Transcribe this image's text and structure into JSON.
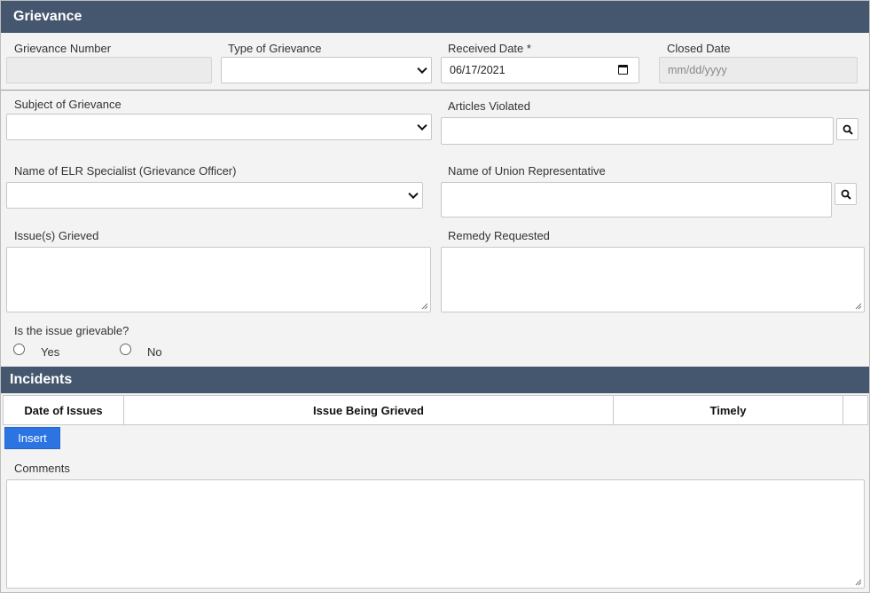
{
  "grievance_section": {
    "title": "Grievance"
  },
  "fields": {
    "grievance_number": {
      "label": "Grievance Number",
      "value": ""
    },
    "type_of_grievance": {
      "label": "Type of Grievance",
      "value": ""
    },
    "received_date": {
      "label": "Received Date *",
      "value": "06/17/2021"
    },
    "closed_date": {
      "label": "Closed Date",
      "placeholder": "mm/dd/yyyy"
    },
    "subject": {
      "label": "Subject of Grievance",
      "value": ""
    },
    "articles_violated": {
      "label": "Articles Violated",
      "value": ""
    },
    "elr_specialist": {
      "label": "Name of ELR Specialist (Grievance Officer)",
      "value": ""
    },
    "union_rep": {
      "label": "Name of Union Representative",
      "value": ""
    },
    "issues_grieved": {
      "label": "Issue(s) Grieved",
      "value": ""
    },
    "remedy_requested": {
      "label": "Remedy Requested",
      "value": ""
    },
    "grievable": {
      "label": "Is the issue grievable?",
      "yes": "Yes",
      "no": "No",
      "selected": null
    },
    "comments": {
      "label": "Comments",
      "value": ""
    }
  },
  "incidents_section": {
    "title": "Incidents",
    "columns": [
      "Date of Issues",
      "Issue Being Grieved",
      "Timely"
    ],
    "insert_label": "Insert"
  }
}
